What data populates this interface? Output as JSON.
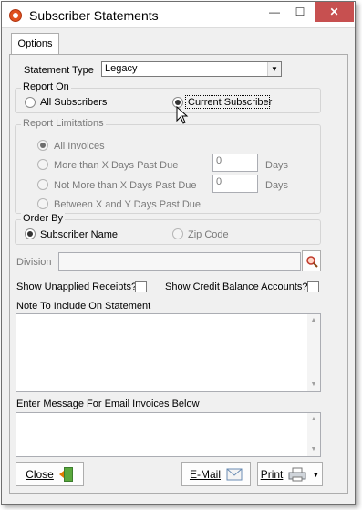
{
  "window": {
    "title": "Subscriber Statements",
    "minimize_glyph": "—",
    "maximize_glyph": "☐",
    "close_glyph": "✕"
  },
  "tabs": [
    {
      "label": "Options",
      "selected": true
    }
  ],
  "statement_type": {
    "label": "Statement Type",
    "value": "Legacy"
  },
  "report_on": {
    "title": "Report On",
    "options": [
      {
        "label": "All Subscribers",
        "checked": false
      },
      {
        "label": "Current Subscriber",
        "checked": true
      }
    ]
  },
  "report_limitations": {
    "title": "Report Limitations",
    "options": [
      {
        "label": "All Invoices",
        "checked": true
      },
      {
        "label": "More than X Days Past Due",
        "checked": false,
        "value": "0",
        "unit": "Days"
      },
      {
        "label": "Not More than X Days Past Due",
        "checked": false,
        "value": "0",
        "unit": "Days"
      },
      {
        "label": "Between X and Y Days Past Due",
        "checked": false
      }
    ]
  },
  "order_by": {
    "title": "Order By",
    "options": [
      {
        "label": "Subscriber Name",
        "checked": true
      },
      {
        "label": "Zip Code",
        "checked": false
      }
    ]
  },
  "division": {
    "label": "Division",
    "value": ""
  },
  "show_unapplied": {
    "label": "Show Unapplied Receipts?",
    "checked": false
  },
  "show_credit": {
    "label": "Show Credit Balance Accounts?",
    "checked": false
  },
  "note": {
    "label": "Note To Include On Statement",
    "value": ""
  },
  "email_message": {
    "label": "Enter Message For Email Invoices Below",
    "value": ""
  },
  "buttons": {
    "close": "Close",
    "email": "E-Mail",
    "print": "Print"
  },
  "icons": {
    "app": "app-logo-icon",
    "search": "magnifier-icon",
    "close": "exit-door-icon",
    "email": "envelope-icon",
    "print": "printer-icon"
  }
}
